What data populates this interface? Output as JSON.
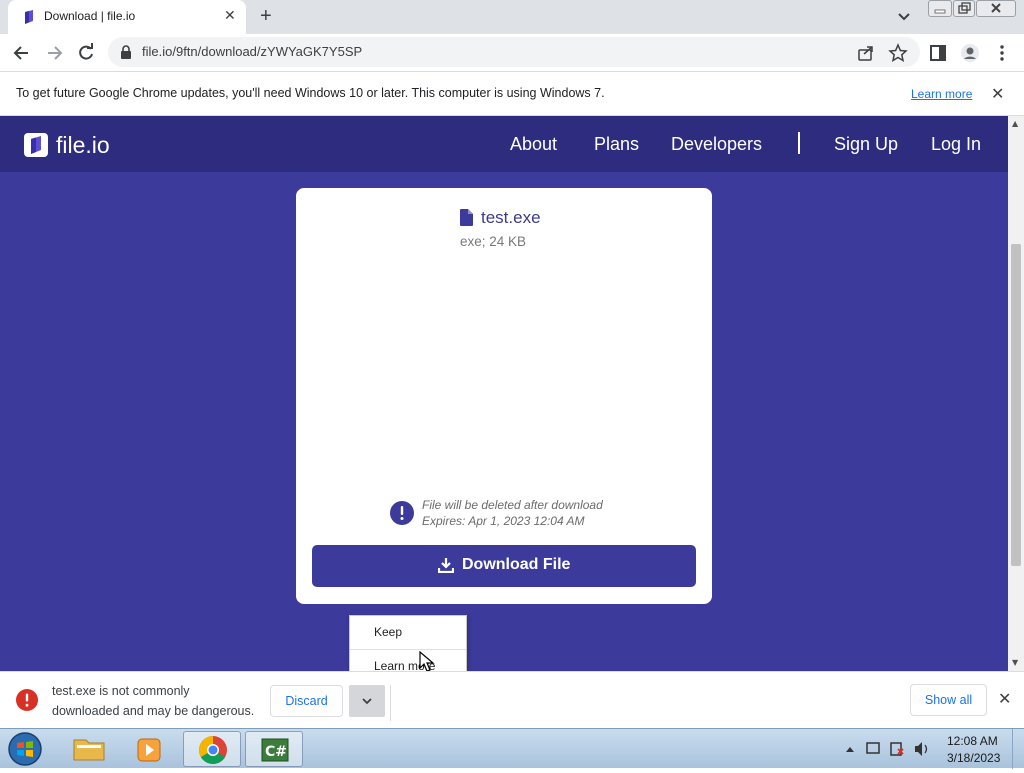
{
  "browser": {
    "tab": {
      "title": "Download | file.io",
      "close_glyph": "✕"
    },
    "new_tab_glyph": "+",
    "url": "file.io/9ftn/download/zYWYaGK7Y5SP"
  },
  "infobar": {
    "message": "To get future Google Chrome updates, you'll need Windows 10 or later. This computer is using Windows 7.",
    "learn_more": "Learn more",
    "close_glyph": "✕"
  },
  "site": {
    "logo_text": "file.io",
    "nav": [
      "About",
      "Plans",
      "Developers",
      "Sign Up",
      "Log In"
    ],
    "brand_color": "#3c3a9a"
  },
  "file": {
    "name": "test.exe",
    "meta": "exe; 24 KB",
    "note_line1": "File will be deleted after download",
    "note_line2": "Expires: Apr 1, 2023 12:04 AM",
    "download_label": "Download File"
  },
  "context_menu": {
    "items": [
      "Keep",
      "Learn more"
    ]
  },
  "download_shelf": {
    "warning_line1": "test.exe is not commonly",
    "warning_line2": "downloaded and may be dangerous.",
    "discard_label": "Discard",
    "show_all_label": "Show all",
    "close_glyph": "✕"
  },
  "taskbar": {
    "time": "12:08 AM",
    "date": "3/18/2023"
  }
}
